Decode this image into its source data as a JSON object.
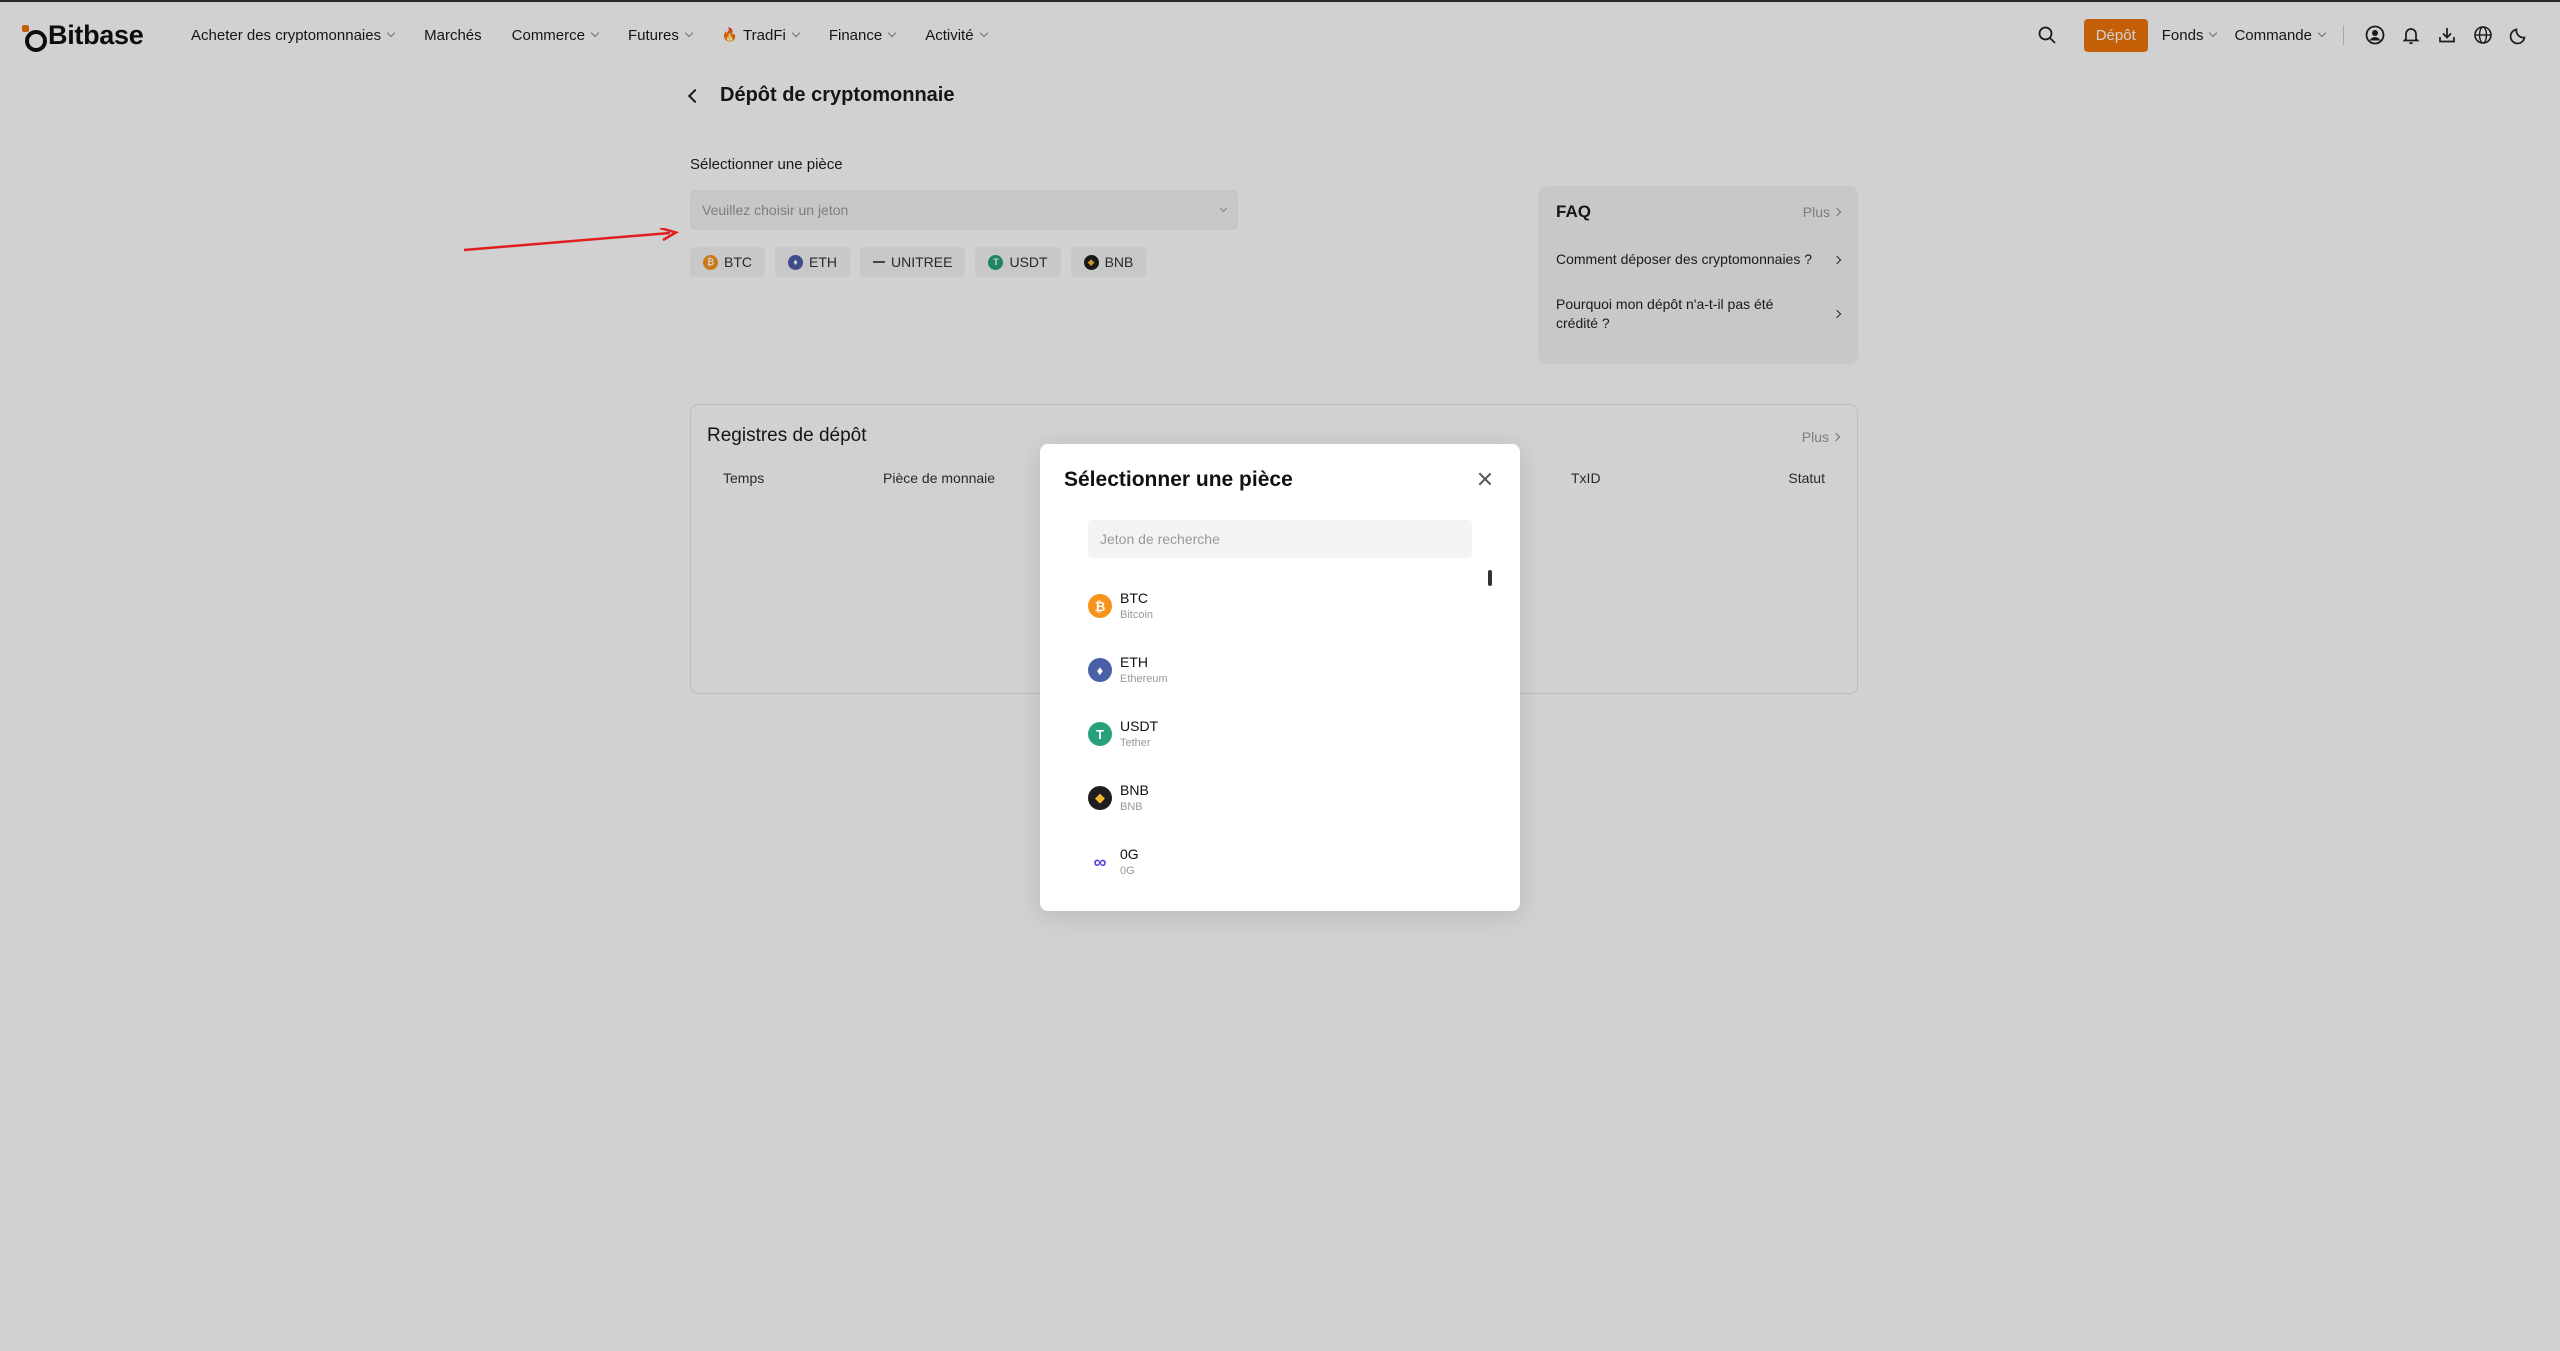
{
  "app": {
    "logo_text": "Bitbase"
  },
  "nav": {
    "items": [
      {
        "label": "Acheter des cryptomonnaies",
        "dropdown": true
      },
      {
        "label": "Marchés",
        "dropdown": false
      },
      {
        "label": "Commerce",
        "dropdown": true
      },
      {
        "label": "Futures",
        "dropdown": true
      },
      {
        "label": "TradFi",
        "dropdown": true,
        "icon": "fire-icon"
      },
      {
        "label": "Finance",
        "dropdown": true
      },
      {
        "label": "Activité",
        "dropdown": true
      }
    ],
    "deposit_label": "Dépôt",
    "funds_label": "Fonds",
    "orders_label": "Commande"
  },
  "page": {
    "title": "Dépôt de cryptomonnaie",
    "select_label": "Sélectionner une pièce",
    "select_placeholder": "Veuillez choisir un jeton",
    "quick_coins": [
      {
        "symbol": "BTC",
        "color": "#f7931a"
      },
      {
        "symbol": "ETH",
        "color": "#4a5fa8"
      },
      {
        "symbol": "UNITREE",
        "color": "#888888"
      },
      {
        "symbol": "USDT",
        "color": "#26a17b"
      },
      {
        "symbol": "BNB",
        "color": "#1e1e1e"
      }
    ]
  },
  "faq": {
    "title": "FAQ",
    "more_label": "Plus",
    "questions": [
      "Comment déposer des cryptomonnaies ?",
      "Pourquoi mon dépôt n'a-t-il pas été crédité ?"
    ]
  },
  "records": {
    "title": "Registres de dépôt",
    "more_label": "Plus",
    "columns": [
      "Temps",
      "Pièce de monnaie",
      "TxID",
      "Statut"
    ]
  },
  "modal": {
    "title": "Sélectionner une pièce",
    "search_placeholder": "Jeton de recherche",
    "coins": [
      {
        "symbol": "BTC",
        "name": "Bitcoin",
        "color": "#f7931a",
        "glyph": "₿"
      },
      {
        "symbol": "ETH",
        "name": "Ethereum",
        "color": "#4a5fa8",
        "glyph": "♦"
      },
      {
        "symbol": "USDT",
        "name": "Tether",
        "color": "#26a17b",
        "glyph": "T"
      },
      {
        "symbol": "BNB",
        "name": "BNB",
        "color": "#1e1e1e",
        "glyph": "◆"
      },
      {
        "symbol": "0G",
        "name": "0G",
        "color": "#ffffff",
        "glyph": "∞"
      }
    ]
  },
  "colors": {
    "accent": "#f0740a",
    "annotation_arrow": "#e02020"
  }
}
